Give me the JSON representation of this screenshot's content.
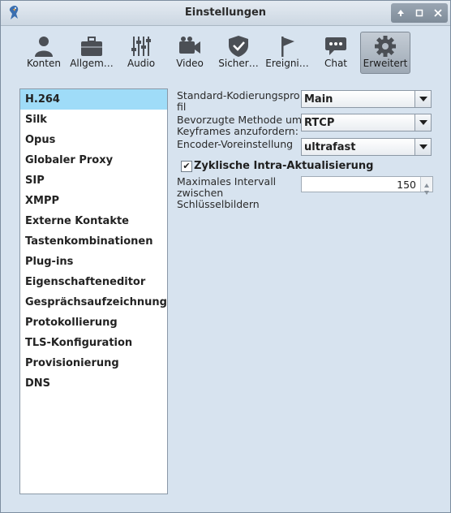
{
  "window": {
    "title": "Einstellungen"
  },
  "toolbar": {
    "items": [
      {
        "label": "Konten",
        "icon": "person-icon"
      },
      {
        "label": "Allgem…",
        "icon": "briefcase-icon"
      },
      {
        "label": "Audio",
        "icon": "sliders-icon"
      },
      {
        "label": "Video",
        "icon": "video-camera-icon"
      },
      {
        "label": "Sicher…",
        "icon": "shield-icon"
      },
      {
        "label": "Ereigni…",
        "icon": "flag-icon"
      },
      {
        "label": "Chat",
        "icon": "chat-bubble-icon"
      },
      {
        "label": "Erweitert",
        "icon": "gear-icon",
        "active": true
      }
    ]
  },
  "sidebar": {
    "items": [
      {
        "label": "H.264",
        "selected": true
      },
      {
        "label": "Silk"
      },
      {
        "label": "Opus"
      },
      {
        "label": "Globaler Proxy"
      },
      {
        "label": "SIP"
      },
      {
        "label": "XMPP"
      },
      {
        "label": "Externe Kontakte"
      },
      {
        "label": "Tastenkombinationen"
      },
      {
        "label": "Plug-ins"
      },
      {
        "label": "Eigenschafteneditor"
      },
      {
        "label": "Gesprächsaufzeichnung"
      },
      {
        "label": "Protokollierung"
      },
      {
        "label": "TLS-Konfiguration"
      },
      {
        "label": "Provisionierung"
      },
      {
        "label": "DNS"
      }
    ]
  },
  "settings": {
    "profile": {
      "label_line1": "Standard-Kodierungspro",
      "label_line2": "fil",
      "value": "Main"
    },
    "keyframe": {
      "label_line1": "Bevorzugte Methode um",
      "label_line2": "Keyframes anzufordern:",
      "value": "RTCP"
    },
    "preset": {
      "label": "Encoder-Voreinstellung",
      "value": "ultrafast"
    },
    "intra_refresh": {
      "label": "Zyklische Intra-Aktualisierung",
      "checked": true,
      "mark": "✔"
    },
    "max_interval": {
      "label_line1": "Maximales Intervall",
      "label_line2": "zwischen",
      "label_line3": "Schlüsselbildern",
      "value": "150"
    }
  },
  "colors": {
    "selection": "#9fdcf8",
    "background": "#d7e3ef"
  }
}
